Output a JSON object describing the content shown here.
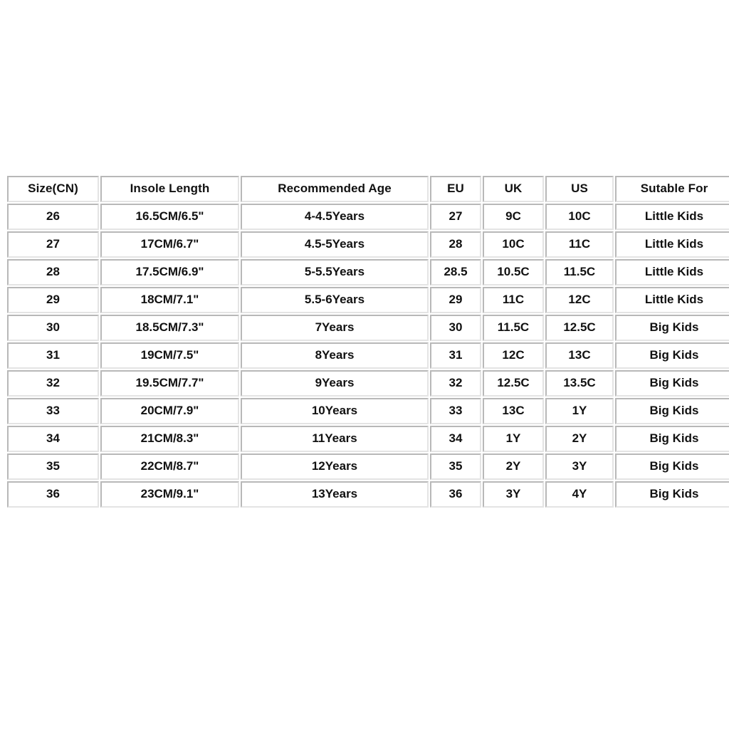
{
  "table": {
    "name": "kids-shoe-size-chart",
    "columns": [
      {
        "key": "size_cn",
        "label": "Size(CN)"
      },
      {
        "key": "insole_length",
        "label": "Insole Length"
      },
      {
        "key": "recommended_age",
        "label": "Recommended Age"
      },
      {
        "key": "eu",
        "label": "EU"
      },
      {
        "key": "uk",
        "label": "UK"
      },
      {
        "key": "us",
        "label": "US"
      },
      {
        "key": "suitable_for",
        "label": "Sutable For"
      }
    ],
    "rows": [
      {
        "size_cn": "26",
        "insole_length": "16.5CM/6.5\"",
        "recommended_age": "4-4.5Years",
        "eu": "27",
        "uk": "9C",
        "us": "10C",
        "suitable_for": "Little Kids"
      },
      {
        "size_cn": "27",
        "insole_length": "17CM/6.7\"",
        "recommended_age": "4.5-5Years",
        "eu": "28",
        "uk": "10C",
        "us": "11C",
        "suitable_for": "Little Kids"
      },
      {
        "size_cn": "28",
        "insole_length": "17.5CM/6.9\"",
        "recommended_age": "5-5.5Years",
        "eu": "28.5",
        "uk": "10.5C",
        "us": "11.5C",
        "suitable_for": "Little Kids"
      },
      {
        "size_cn": "29",
        "insole_length": "18CM/7.1\"",
        "recommended_age": "5.5-6Years",
        "eu": "29",
        "uk": "11C",
        "us": "12C",
        "suitable_for": "Little Kids"
      },
      {
        "size_cn": "30",
        "insole_length": "18.5CM/7.3\"",
        "recommended_age": "7Years",
        "eu": "30",
        "uk": "11.5C",
        "us": "12.5C",
        "suitable_for": "Big Kids"
      },
      {
        "size_cn": "31",
        "insole_length": "19CM/7.5\"",
        "recommended_age": "8Years",
        "eu": "31",
        "uk": "12C",
        "us": "13C",
        "suitable_for": "Big Kids"
      },
      {
        "size_cn": "32",
        "insole_length": "19.5CM/7.7\"",
        "recommended_age": "9Years",
        "eu": "32",
        "uk": "12.5C",
        "us": "13.5C",
        "suitable_for": "Big Kids"
      },
      {
        "size_cn": "33",
        "insole_length": "20CM/7.9\"",
        "recommended_age": "10Years",
        "eu": "33",
        "uk": "13C",
        "us": "1Y",
        "suitable_for": "Big Kids"
      },
      {
        "size_cn": "34",
        "insole_length": "21CM/8.3\"",
        "recommended_age": "11Years",
        "eu": "34",
        "uk": "1Y",
        "us": "2Y",
        "suitable_for": "Big Kids"
      },
      {
        "size_cn": "35",
        "insole_length": "22CM/8.7\"",
        "recommended_age": "12Years",
        "eu": "35",
        "uk": "2Y",
        "us": "3Y",
        "suitable_for": "Big Kids"
      },
      {
        "size_cn": "36",
        "insole_length": "23CM/9.1\"",
        "recommended_age": "13Years",
        "eu": "36",
        "uk": "3Y",
        "us": "4Y",
        "suitable_for": "Big Kids"
      }
    ]
  },
  "colors": {
    "page_background": "#ffffff",
    "cell_background": "#ffffff",
    "text": "#111111",
    "border_dark": "#b8b8b8",
    "border_light": "#e4e4e4"
  }
}
